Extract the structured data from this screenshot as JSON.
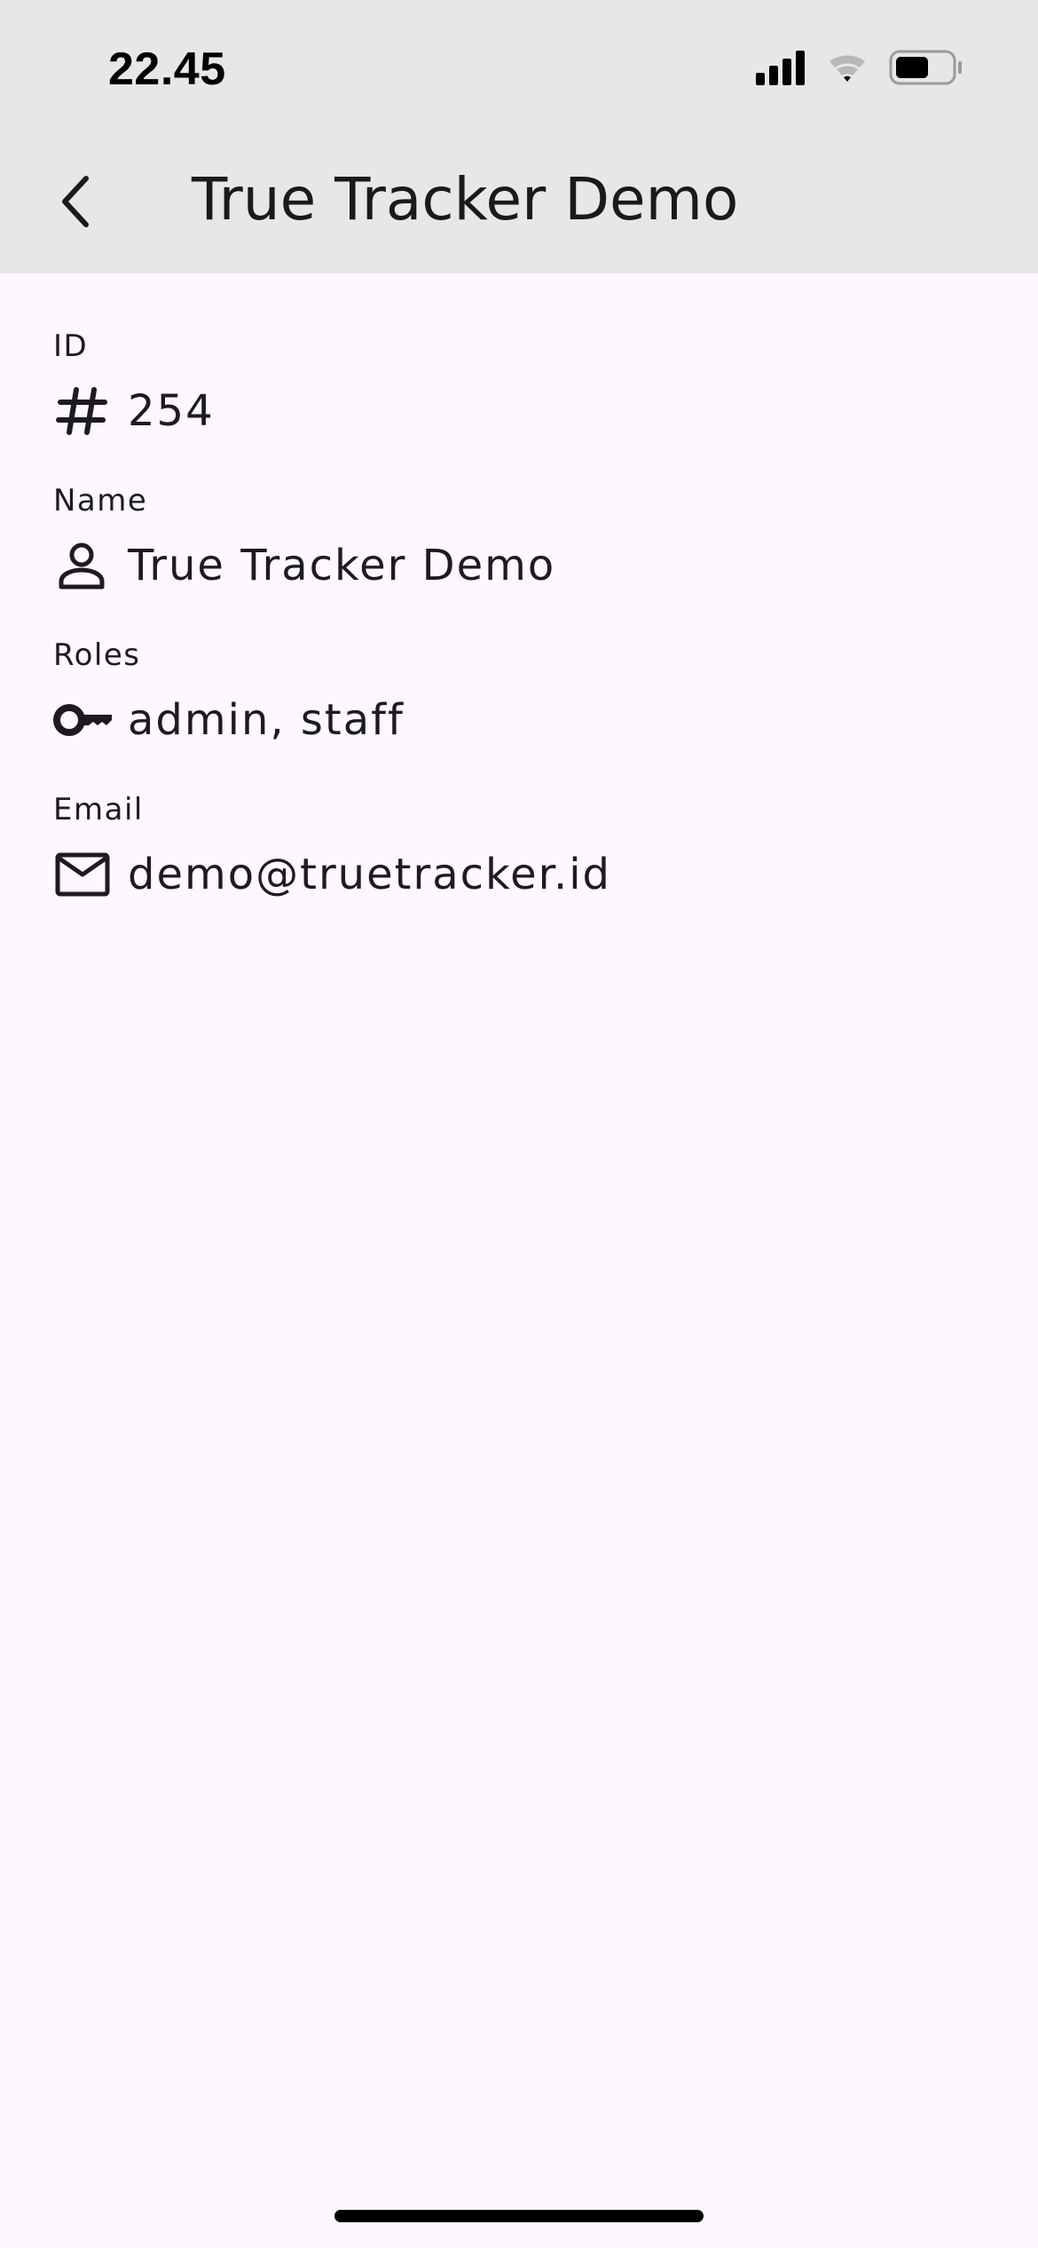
{
  "status_bar": {
    "time": "22.45",
    "icons": [
      "cellular-signal-icon",
      "wifi-icon",
      "battery-icon"
    ]
  },
  "app_bar": {
    "back_icon": "chevron-left-icon",
    "title": "True Tracker Demo"
  },
  "fields": [
    {
      "label": "ID",
      "icon": "hash-icon",
      "value": "254"
    },
    {
      "label": "Name",
      "icon": "person-icon",
      "value": "True Tracker Demo"
    },
    {
      "label": "Roles",
      "icon": "key-icon",
      "value": "admin, staff"
    },
    {
      "label": "Email",
      "icon": "mail-icon",
      "value": "demo@truetracker.id"
    }
  ],
  "colors": {
    "app_bar_bg": "#e7e7e7",
    "page_bg": "#fdf7ff",
    "text": "#1d1b20"
  }
}
